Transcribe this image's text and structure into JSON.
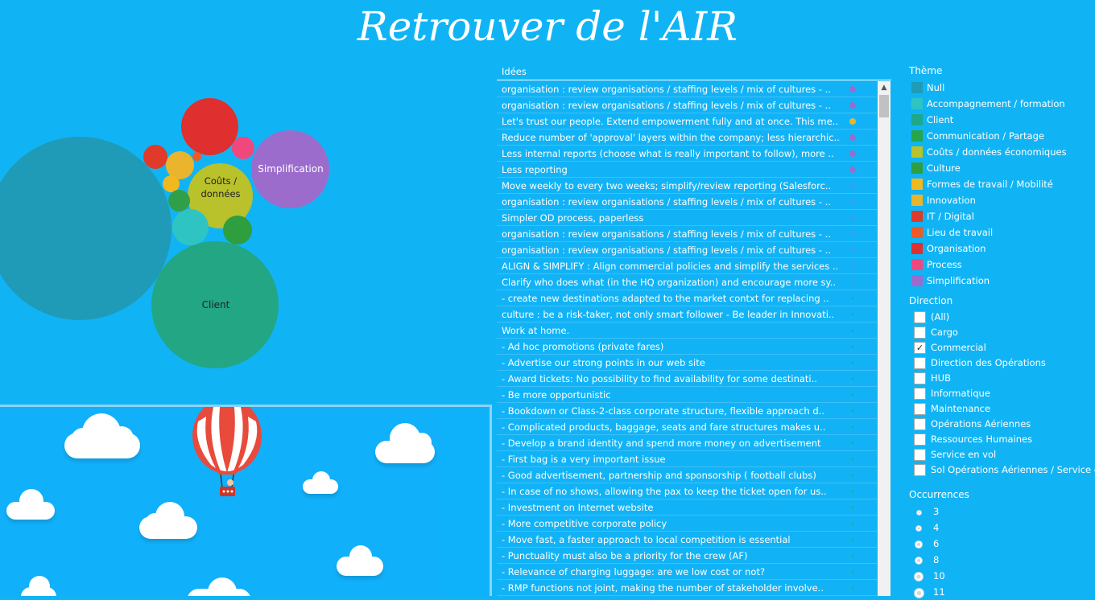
{
  "title": "Retrouver de l'AIR",
  "bubbles": {
    "labels": {
      "couts": "Coûts /\ndonnées",
      "simplification": "Simplification",
      "client": "Client"
    }
  },
  "ideas": {
    "header": "Idées",
    "rows": [
      {
        "text": "organisation : review organisations / staffing levels / mix of cultures - ..",
        "dot": "#9b6ccc"
      },
      {
        "text": "organisation : review organisations / staffing levels / mix of cultures - ..",
        "dot": "#9b6ccc"
      },
      {
        "text": "Let's trust our people. Extend empowerment fully and at once. This me..",
        "dot": "#e9b62a"
      },
      {
        "text": "Reduce number of 'approval' layers within the company; less hierarchic..",
        "dot": "#9b6ccc"
      },
      {
        "text": "Less internal reports (choose what is really important to follow), more ..",
        "dot": "#9b6ccc"
      },
      {
        "text": "Less reporting",
        "dot": "#9b6ccc"
      },
      {
        "text": "Move weekly to every two weeks; simplify/review reporting (Salesforc..",
        "dot": "#9b6ccc",
        "small": true
      },
      {
        "text": "organisation : review organisations / staffing levels / mix of cultures - ..",
        "dot": "#9b6ccc",
        "small": true
      },
      {
        "text": "Simpler OD process, paperless",
        "dot": "#9b6ccc",
        "small": true
      },
      {
        "text": "organisation : review organisations / staffing levels / mix of cultures - ..",
        "dot": "#9b6ccc",
        "small": true
      },
      {
        "text": "organisation : review organisations / staffing levels / mix of cultures - ..",
        "dot": "#9b6ccc",
        "small": true
      },
      {
        "text": "ALIGN & SIMPLIFY : Align commercial policies and simplify the services ..",
        "dot": "#9b6ccc",
        "small": true
      },
      {
        "text": "Clarify who does what (in the HQ organization) and encourage more sy..",
        "dot": "#9b6ccc",
        "small": true
      },
      {
        "text": " - create new destinations adapted to the market contxt  for replacing ..",
        "dot": "#26a88a",
        "small": true
      },
      {
        "text": " culture : be a risk-taker, not only smart follower - Be leader in Innovati..",
        "dot": "#26a88a",
        "small": true
      },
      {
        "text": " Work at home.",
        "dot": "#26a88a",
        "small": true
      },
      {
        "text": "-      Ad hoc promotions (private fares)",
        "dot": "#26a88a",
        "small": true
      },
      {
        "text": "-      Advertise our strong points in our web site",
        "dot": "#26a88a",
        "small": true
      },
      {
        "text": "-      Award tickets: No possibility to find availability for some destinati..",
        "dot": "#26a88a",
        "small": true
      },
      {
        "text": "-      Be more opportunistic",
        "dot": "#26a88a",
        "small": true
      },
      {
        "text": "-      Bookdown or Class-2-class corporate structure, flexible approach d..",
        "dot": "#26a88a",
        "small": true
      },
      {
        "text": "-      Complicated products, baggage, seats and fare structures makes u..",
        "dot": "#26a88a",
        "small": true
      },
      {
        "text": "-      Develop a brand identity and spend more money on advertisement",
        "dot": "#26a88a",
        "small": true
      },
      {
        "text": "-      First bag is a very important issue",
        "dot": "#26a88a",
        "small": true
      },
      {
        "text": "-      Good advertisement, partnership and sponsorship ( football clubs)",
        "dot": "#26a88a",
        "small": true
      },
      {
        "text": "-      In case of no shows, allowing the pax to keep the ticket open for us..",
        "dot": "#26a88a",
        "small": true
      },
      {
        "text": "-      Investment on Internet website",
        "dot": "#26a88a",
        "small": true
      },
      {
        "text": "-      More competitive corporate policy",
        "dot": "#26a88a",
        "small": true
      },
      {
        "text": "-      Move fast, a faster approach to local competition is essential",
        "dot": "#26a88a",
        "small": true
      },
      {
        "text": "-      Punctuality must also be a priority for the crew (AF)",
        "dot": "#26a88a",
        "small": true
      },
      {
        "text": "-      Relevance of charging luggage: are we low cost or not?",
        "dot": "#26a88a",
        "small": true
      },
      {
        "text": "-      RMP functions not joint, making the number of stakeholder involve..",
        "dot": "#26a88a",
        "small": true
      }
    ]
  },
  "theme_legend": {
    "title": "Thème",
    "items": [
      {
        "label": "Null",
        "color": "#1f9bb8"
      },
      {
        "label": "Accompagnement / formation",
        "color": "#2fc4c4"
      },
      {
        "label": "Client",
        "color": "#1fa888"
      },
      {
        "label": "Communication / Partage",
        "color": "#26a54a"
      },
      {
        "label": "Coûts / données économiques",
        "color": "#b8c22a"
      },
      {
        "label": "Culture",
        "color": "#2f9e3f"
      },
      {
        "label": "Formes de travail / Mobilité",
        "color": "#f2b81f"
      },
      {
        "label": "Innovation",
        "color": "#eab52c"
      },
      {
        "label": "IT / Digital",
        "color": "#e03a2a"
      },
      {
        "label": "Lieu de travail",
        "color": "#ee5a24"
      },
      {
        "label": "Organisation",
        "color": "#df2f2f"
      },
      {
        "label": "Process",
        "color": "#f0477d"
      },
      {
        "label": "Simplification",
        "color": "#9b6ccc"
      }
    ]
  },
  "direction_filter": {
    "title": "Direction",
    "items": [
      {
        "label": "(All)",
        "checked": false
      },
      {
        "label": "Cargo",
        "checked": false
      },
      {
        "label": "Commercial",
        "checked": true
      },
      {
        "label": "Direction des Opérations",
        "checked": false
      },
      {
        "label": "HUB",
        "checked": false
      },
      {
        "label": "Informatique",
        "checked": false
      },
      {
        "label": "Maintenance",
        "checked": false
      },
      {
        "label": "Opérations Aériennes",
        "checked": false
      },
      {
        "label": "Ressources Humaines",
        "checked": false
      },
      {
        "label": "Service en vol",
        "checked": false
      },
      {
        "label": "Sol Opérations Aériennes / Service en vol",
        "checked": false
      }
    ],
    "check_mark": "✓"
  },
  "occurrences": {
    "title": "Occurrences",
    "items": [
      "3",
      "4",
      "6",
      "8",
      "10",
      "11"
    ]
  },
  "scroll_up_glyph": "▲"
}
